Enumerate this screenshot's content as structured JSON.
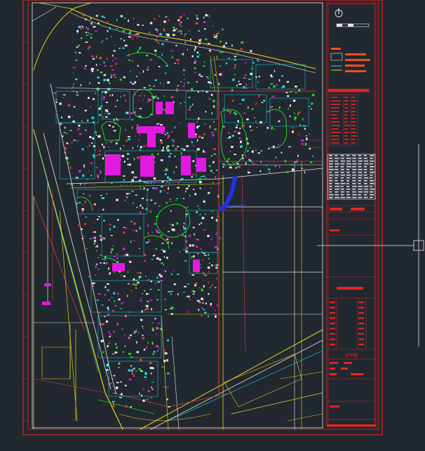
{
  "colors": {
    "background": "#212830",
    "frame": "#e8221f",
    "road_yellow": "#e6d21a",
    "road_white": "#e8e8e8",
    "road_red": "#e4393c",
    "green": "#21d81f",
    "magenta": "#e21ae0",
    "cyan": "#1fd8e0",
    "blue": "#2233e0",
    "orange": "#f0501e"
  },
  "icons": {
    "north_arrow": "compass-north-icon",
    "crosshair": "cad-crosshair-cursor-icon"
  },
  "title_block": {
    "plan_name": "总平面"
  }
}
